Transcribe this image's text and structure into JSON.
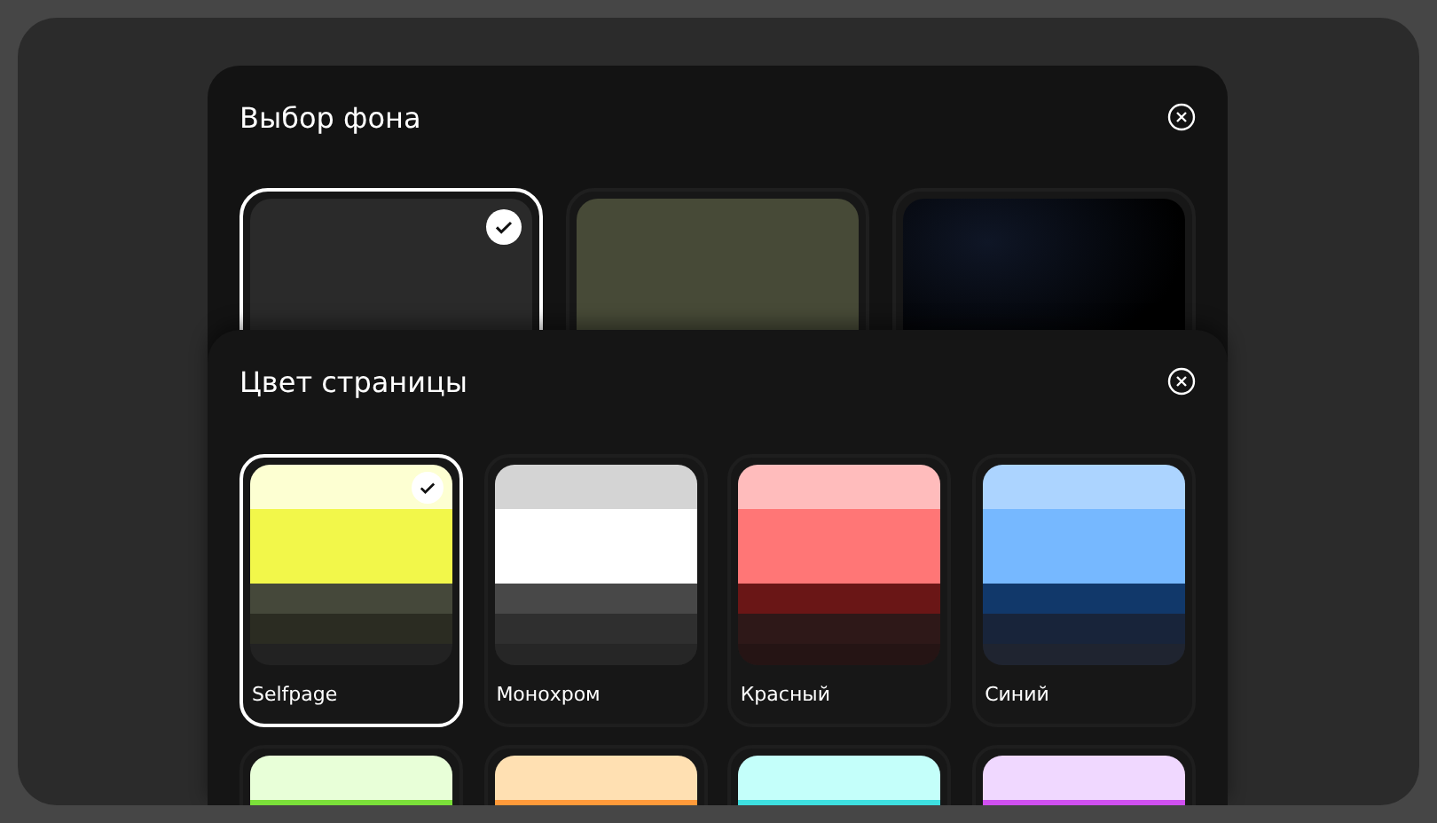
{
  "background_sheet": {
    "title": "Выбор фона",
    "backgrounds": [
      {
        "kind": "solid",
        "color": "#2a2a2a",
        "selected": true
      },
      {
        "kind": "solid",
        "color": "#474a37",
        "selected": false
      },
      {
        "kind": "gradient",
        "color": "#0f1626",
        "selected": false
      }
    ]
  },
  "page_color_sheet": {
    "title": "Цвет страницы",
    "palettes": [
      {
        "name": "Selfpage",
        "selected": true,
        "swatches": [
          {
            "color": "#fdffd2"
          },
          {
            "color": "#f2f74a"
          },
          {
            "color": "#45483a"
          },
          {
            "color": "#2b2c22"
          }
        ]
      },
      {
        "name": "Монохром",
        "selected": false,
        "swatches": [
          {
            "color": "#d4d4d4"
          },
          {
            "color": "#ffffff"
          },
          {
            "color": "#484848"
          },
          {
            "color": "#2f2f2f"
          },
          {
            "color": "#262626"
          }
        ]
      },
      {
        "name": "Красный",
        "selected": false,
        "swatches": [
          {
            "color": "#ffbcbc"
          },
          {
            "color": "#ff7676"
          },
          {
            "color": "#6a1616"
          },
          {
            "color": "#2e1818"
          },
          {
            "color": "#251414"
          }
        ]
      },
      {
        "name": "Синий",
        "selected": false,
        "swatches": [
          {
            "color": "#acd4ff"
          },
          {
            "color": "#76b8ff"
          },
          {
            "color": "#11386a"
          },
          {
            "color": "#18243a"
          },
          {
            "color": "#1f2430"
          }
        ]
      },
      {
        "selected": false,
        "swatches": [
          {
            "color": "#e8ffd8"
          },
          {
            "color": "#7be03a"
          }
        ]
      },
      {
        "selected": false,
        "swatches": [
          {
            "color": "#ffe0b2"
          },
          {
            "color": "#ff9a3a"
          }
        ]
      },
      {
        "selected": false,
        "swatches": [
          {
            "color": "#c4fffa"
          },
          {
            "color": "#3ee0e0"
          }
        ]
      },
      {
        "selected": false,
        "swatches": [
          {
            "color": "#f0d8ff"
          },
          {
            "color": "#d050f0"
          }
        ]
      }
    ]
  }
}
